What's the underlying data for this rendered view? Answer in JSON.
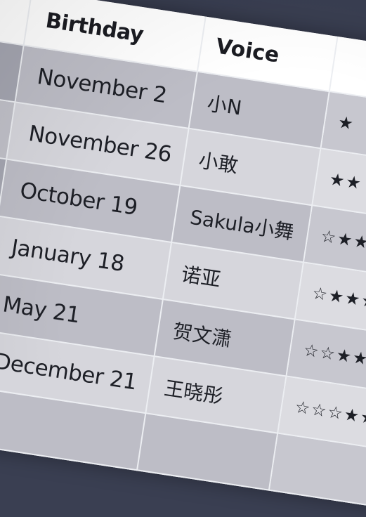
{
  "table": {
    "columns": [
      "",
      "Birthday",
      "Voice",
      ""
    ],
    "rows": [
      {
        "birthday": "November 2",
        "voice": "小N",
        "rarity": "★"
      },
      {
        "birthday": "November 26",
        "voice": "小敢",
        "rarity": "★★"
      },
      {
        "birthday": "October 19",
        "voice": "Sakula小舞",
        "rarity": "☆★★"
      },
      {
        "birthday": "January 18",
        "voice": "诺亚",
        "rarity": "☆★★★"
      },
      {
        "birthday": "May 21",
        "voice": "贺文潇",
        "rarity": "☆☆★★★"
      },
      {
        "birthday": "December 21",
        "voice": "王晓彤",
        "rarity": "☆☆☆★★"
      },
      {
        "birthday": "",
        "voice": "",
        "rarity": ""
      }
    ]
  }
}
